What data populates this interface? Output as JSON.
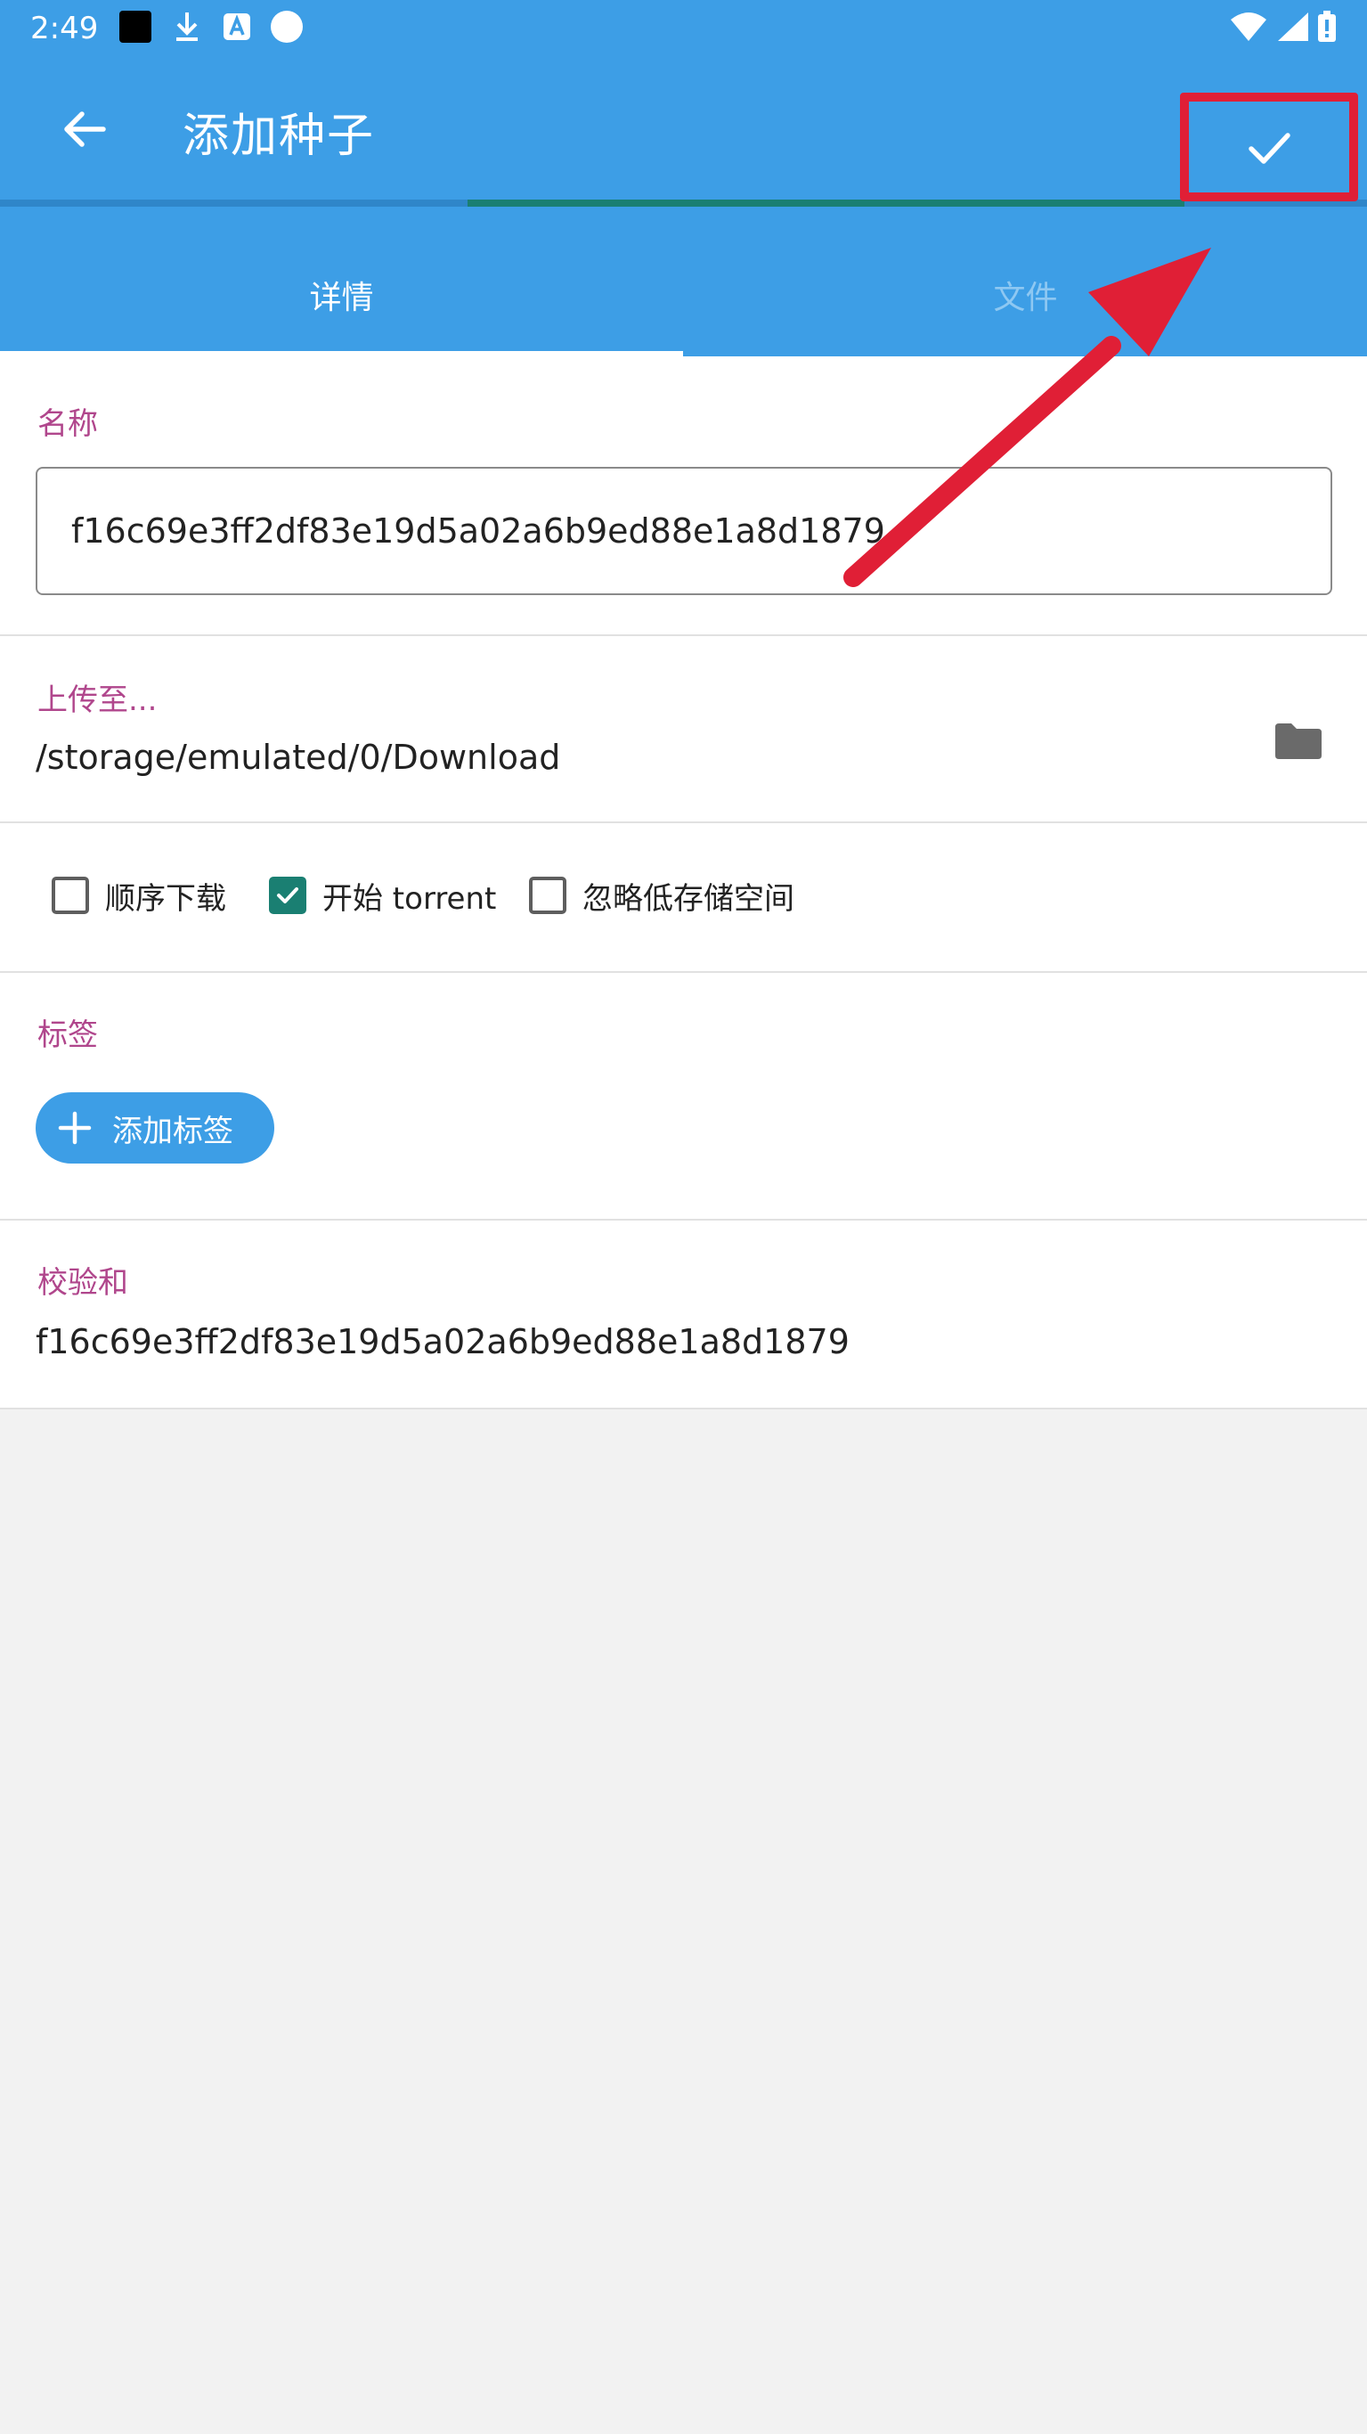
{
  "status_bar": {
    "time": "2:49"
  },
  "toolbar": {
    "title": "添加种子"
  },
  "tabs": [
    {
      "label": "详情"
    },
    {
      "label": "文件"
    }
  ],
  "form": {
    "name_label": "名称",
    "name_value": "f16c69e3ff2df83e19d5a02a6b9ed88e1a8d1879",
    "upload_label": "上传至...",
    "upload_path": "/storage/emulated/0/Download",
    "options": [
      {
        "label": "顺序下载",
        "checked": false
      },
      {
        "label": "开始 torrent",
        "checked": true
      },
      {
        "label": "忽略低存储空间",
        "checked": false
      }
    ],
    "tags_label": "标签",
    "add_tag_label": "添加标签",
    "checksum_label": "校验和",
    "checksum_value": "f16c69e3ff2df83e19d5a02a6b9ed88e1a8d1879"
  },
  "colors": {
    "primary": "#3d9ee6",
    "accent": "#1a7f72",
    "label": "#b0468c",
    "annotation": "#e01f36"
  },
  "icons": {
    "back": "arrow-left-icon",
    "confirm": "check-icon",
    "folder": "folder-icon",
    "add": "plus-icon"
  }
}
